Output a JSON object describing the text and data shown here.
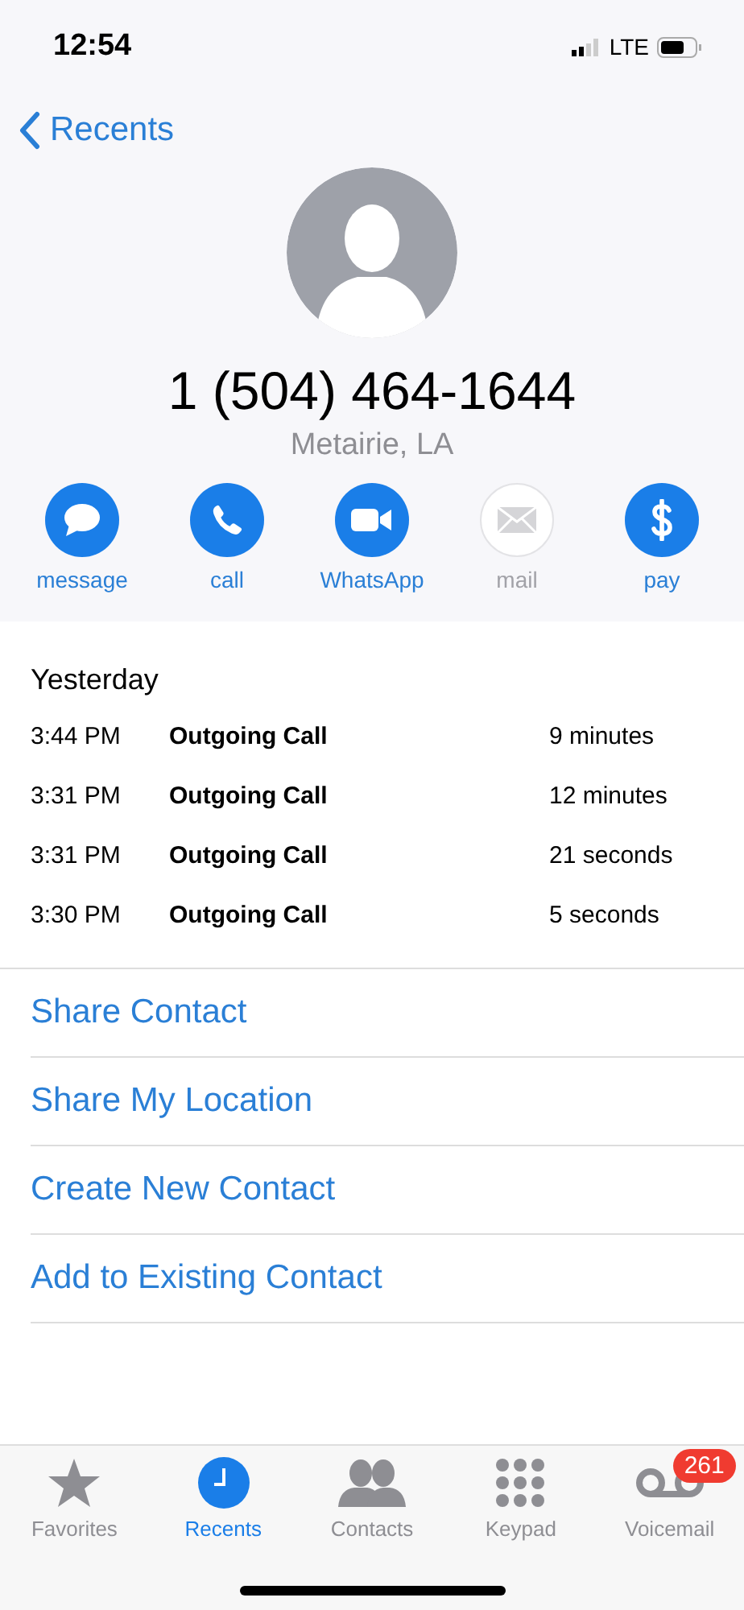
{
  "status_bar": {
    "time": "12:54",
    "network": "LTE"
  },
  "nav": {
    "back": "Recents"
  },
  "contact": {
    "number": "1 (504) 464-1644",
    "location": "Metairie, LA"
  },
  "actions": [
    {
      "kind": "message",
      "label": "message",
      "disabled": false
    },
    {
      "kind": "call",
      "label": "call",
      "disabled": false
    },
    {
      "kind": "video",
      "label": "WhatsApp",
      "disabled": false
    },
    {
      "kind": "mail",
      "label": "mail",
      "disabled": true
    },
    {
      "kind": "pay",
      "label": "pay",
      "disabled": false
    }
  ],
  "history": {
    "day": "Yesterday",
    "calls": [
      {
        "time": "3:44 PM",
        "type": "Outgoing Call",
        "duration": "9 minutes"
      },
      {
        "time": "3:31 PM",
        "type": "Outgoing Call",
        "duration": "12 minutes"
      },
      {
        "time": "3:31 PM",
        "type": "Outgoing Call",
        "duration": "21 seconds"
      },
      {
        "time": "3:30 PM",
        "type": "Outgoing Call",
        "duration": "5 seconds"
      }
    ]
  },
  "links": [
    "Share Contact",
    "Share My Location",
    "Create New Contact",
    "Add to Existing Contact"
  ],
  "tabs": [
    {
      "kind": "favorites",
      "label": "Favorites",
      "selected": false
    },
    {
      "kind": "recents",
      "label": "Recents",
      "selected": true
    },
    {
      "kind": "contacts",
      "label": "Contacts",
      "selected": false
    },
    {
      "kind": "keypad",
      "label": "Keypad",
      "selected": false
    },
    {
      "kind": "voicemail",
      "label": "Voicemail",
      "selected": false,
      "badge": "261"
    }
  ]
}
